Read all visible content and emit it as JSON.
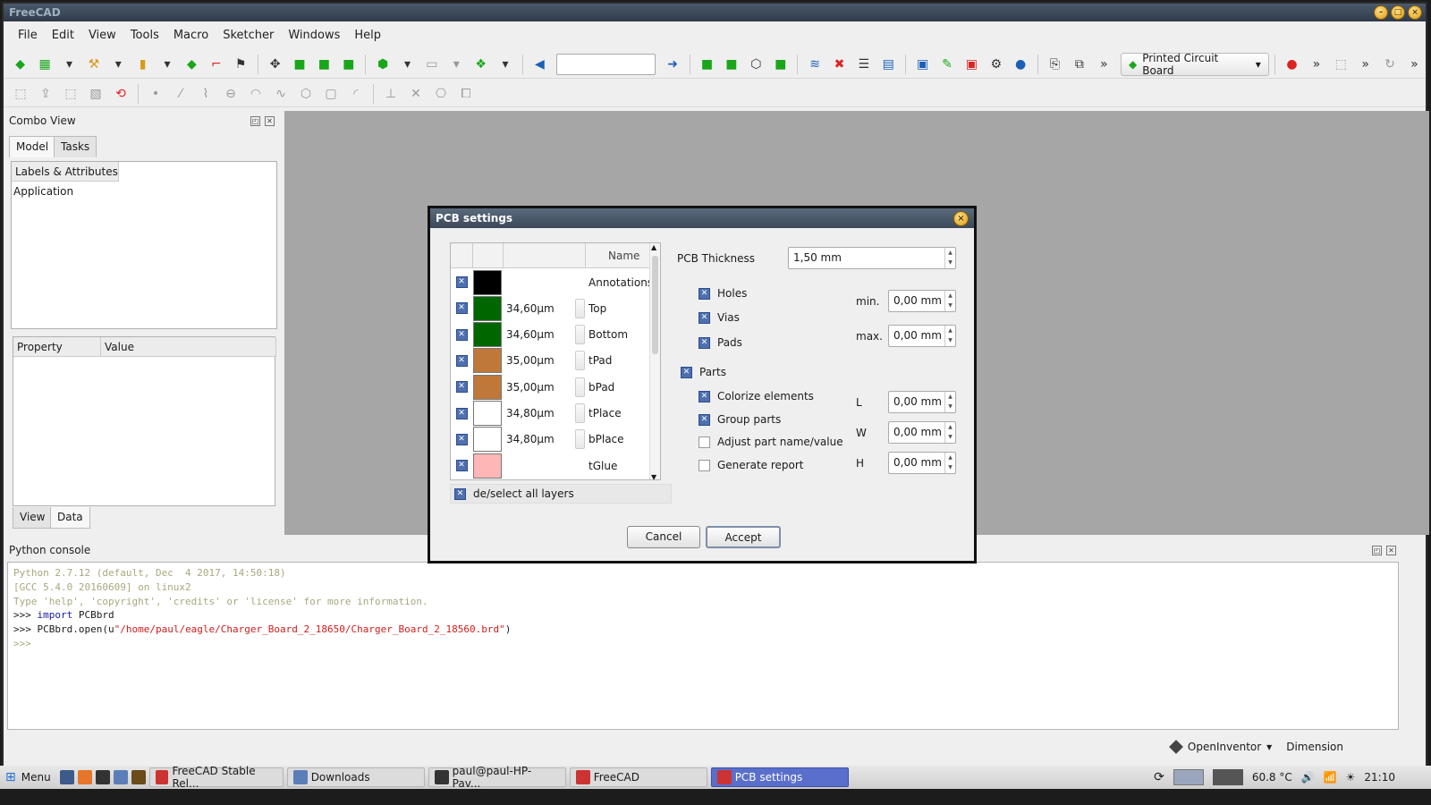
{
  "app": {
    "title": "FreeCAD"
  },
  "menu": [
    "File",
    "Edit",
    "View",
    "Tools",
    "Macro",
    "Sketcher",
    "Windows",
    "Help"
  ],
  "toolbar": {
    "workbench": "Printed Circuit Board"
  },
  "combo": {
    "title": "Combo View",
    "tabs": [
      "Model",
      "Tasks"
    ],
    "tree_header": "Labels & Attributes",
    "tree_item": "Application",
    "prop_headers": [
      "Property",
      "Value"
    ],
    "bottom_tabs": [
      "View",
      "Data"
    ]
  },
  "python": {
    "title": "Python console",
    "lines": {
      "l1": "Python 2.7.12 (default, Dec  4 2017, 14:50:18)",
      "l2": "[GCC 5.4.0 20160609] on linux2",
      "l3": "Type 'help', 'copyright', 'credits' or 'license' for more information.",
      "l4_prompt": ">>> ",
      "l4_kw": "import",
      "l4_rest": " PCBbrd",
      "l5_prompt": ">>> ",
      "l5_code": "PCBbrd.open(u",
      "l5_str": "\"/home/paul/eagle/Charger_Board_2_18650/Charger_Board_2_18560.brd\"",
      "l5_end": ")",
      "l6": ">>> "
    }
  },
  "status": {
    "nav": "OpenInventor",
    "dim": "Dimension"
  },
  "dialog": {
    "title": "PCB settings",
    "col_name": "Name",
    "layers": [
      {
        "color": "#000000",
        "thickness": "",
        "name": "Annotations",
        "spin": false
      },
      {
        "color": "#006600",
        "thickness": "34,60µm",
        "name": "Top",
        "spin": true
      },
      {
        "color": "#006600",
        "thickness": "34,60µm",
        "name": "Bottom",
        "spin": true
      },
      {
        "color": "#c0783a",
        "thickness": "35,00µm",
        "name": "tPad",
        "spin": true
      },
      {
        "color": "#c0783a",
        "thickness": "35,00µm",
        "name": "bPad",
        "spin": true
      },
      {
        "color": "#ffffff",
        "thickness": "34,80µm",
        "name": "tPlace",
        "spin": true
      },
      {
        "color": "#ffffff",
        "thickness": "34,80µm",
        "name": "bPlace",
        "spin": true
      },
      {
        "color": "#ffb6b6",
        "thickness": "",
        "name": "tGlue",
        "spin": false
      }
    ],
    "deselect": "de/select all layers",
    "thickness_label": "PCB Thickness",
    "thickness_value": "1,50 mm",
    "holes": "Holes",
    "vias": "Vias",
    "pads": "Pads",
    "min_label": "min.",
    "max_label": "max.",
    "min_value": "0,00 mm",
    "max_value": "0,00 mm",
    "parts": "Parts",
    "colorize": "Colorize elements",
    "group": "Group parts",
    "adjust": "Adjust part name/value",
    "report": "Generate report",
    "L": "L",
    "W": "W",
    "H": "H",
    "L_value": "0,00 mm",
    "W_value": "0,00 mm",
    "H_value": "0,00 mm",
    "cancel": "Cancel",
    "accept": "Accept"
  },
  "taskbar": {
    "menu": "Menu",
    "tasks": [
      "FreeCAD Stable Rel...",
      "Downloads",
      "paul@paul-HP-Pav...",
      "FreeCAD",
      "PCB settings"
    ],
    "temp": "60.8 °C",
    "time": "21:10"
  }
}
